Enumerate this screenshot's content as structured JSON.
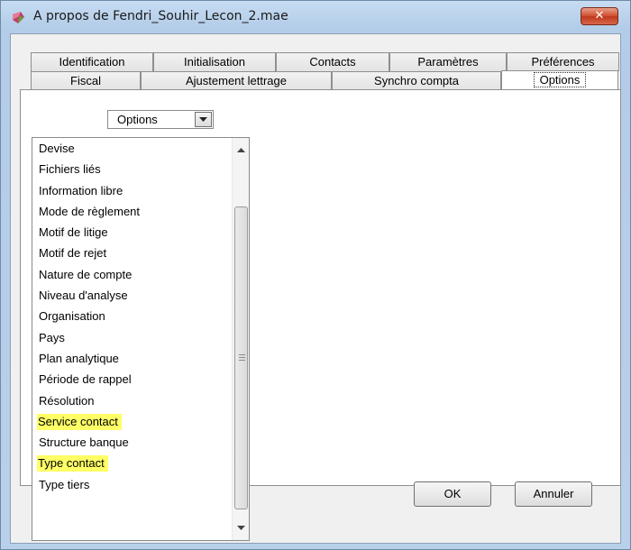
{
  "window": {
    "title": "A propos de Fendri_Souhir_Lecon_2.mae",
    "close_glyph": "✕"
  },
  "tabs": {
    "row1": [
      "Identification",
      "Initialisation",
      "Contacts",
      "Paramètres",
      "Préférences"
    ],
    "row2": [
      "Fiscal",
      "Ajustement lettrage",
      "Synchro compta",
      "Options"
    ],
    "active": "Options"
  },
  "combo": {
    "selected": "Options"
  },
  "list": {
    "items": [
      {
        "label": "Devise",
        "highlighted": false
      },
      {
        "label": "Fichiers liés",
        "highlighted": false
      },
      {
        "label": "Information libre",
        "highlighted": false
      },
      {
        "label": "Mode de règlement",
        "highlighted": false
      },
      {
        "label": "Motif de litige",
        "highlighted": false
      },
      {
        "label": "Motif de rejet",
        "highlighted": false
      },
      {
        "label": "Nature de compte",
        "highlighted": false
      },
      {
        "label": "Niveau d'analyse",
        "highlighted": false
      },
      {
        "label": "Organisation",
        "highlighted": false
      },
      {
        "label": "Pays",
        "highlighted": false
      },
      {
        "label": "Plan analytique",
        "highlighted": false
      },
      {
        "label": "Période de rappel",
        "highlighted": false
      },
      {
        "label": "Résolution",
        "highlighted": false
      },
      {
        "label": "Service contact",
        "highlighted": true
      },
      {
        "label": "Structure banque",
        "highlighted": false
      },
      {
        "label": "Type contact",
        "highlighted": true
      },
      {
        "label": "Type tiers",
        "highlighted": false
      }
    ],
    "highlight_color": "#ffff66"
  },
  "buttons": {
    "ok": "OK",
    "cancel": "Annuler"
  },
  "colors": {
    "titlebar": "#c7dcf2",
    "close": "#c0391b"
  }
}
